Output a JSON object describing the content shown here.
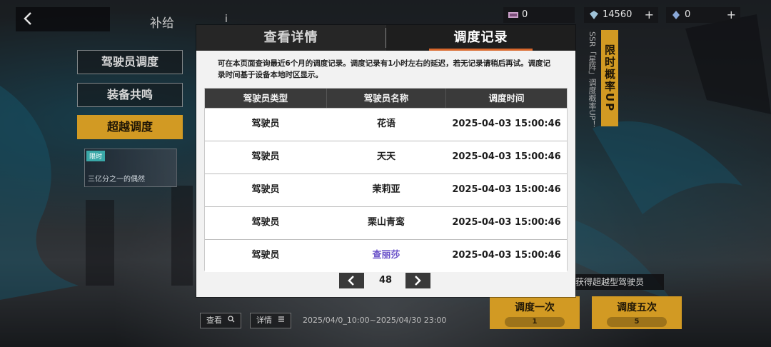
{
  "topbar": {
    "title": "补给",
    "info": "i",
    "currencies": [
      {
        "value": "0",
        "icon": "ticket-icon"
      },
      {
        "value": "14560",
        "icon": "crystal-icon"
      },
      {
        "value": "0",
        "icon": "gem-icon"
      }
    ],
    "plus": "+"
  },
  "menu": {
    "items": [
      {
        "label": "驾驶员调度"
      },
      {
        "label": "装备共鸣"
      },
      {
        "label": "超越调度"
      }
    ],
    "banner": {
      "tag": "限时",
      "text": "三亿分之一的偶然"
    }
  },
  "promo": {
    "vertical": "限时概率UP",
    "vertical_sub": "SSR「星阵」调度概率UP！",
    "strip": "获得超越型驾驶员",
    "pull_one": "调度一次",
    "pull_one_cost": "1",
    "pull_five": "调度五次",
    "pull_five_cost": "5"
  },
  "bottom": {
    "view_label": "查看",
    "detail_label": "详情",
    "date_range": "2025/04/0_10:00~2025/04/30 23:00"
  },
  "modal": {
    "tabs": [
      {
        "label": "查看详情",
        "active": false
      },
      {
        "label": "调度记录",
        "active": true
      }
    ],
    "description": "可在本页面查询最近6个月的调度记录。调度记录有1小时左右的延迟，若无记录请稍后再试。调度记录时间基于设备本地时区显示。",
    "table": {
      "headers": [
        "驾驶员类型",
        "驾驶员名称",
        "调度时间"
      ],
      "rows": [
        {
          "type": "驾驶员",
          "name": "花语",
          "time": "2025-04-03 15:00:46",
          "highlight": false
        },
        {
          "type": "驾驶员",
          "name": "天天",
          "time": "2025-04-03 15:00:46",
          "highlight": false
        },
        {
          "type": "驾驶员",
          "name": "茉莉亚",
          "time": "2025-04-03 15:00:46",
          "highlight": false
        },
        {
          "type": "驾驶员",
          "name": "栗山青鸾",
          "time": "2025-04-03 15:00:46",
          "highlight": false
        },
        {
          "type": "驾驶员",
          "name": "查丽莎",
          "time": "2025-04-03 15:00:46",
          "highlight": true
        }
      ]
    },
    "pager": {
      "page": "48"
    }
  },
  "colors": {
    "accent_gold": "#d29a23",
    "tab_underline": "#d8672b",
    "highlight_name": "#6a52c9",
    "header_dark": "#3a3a3a"
  }
}
